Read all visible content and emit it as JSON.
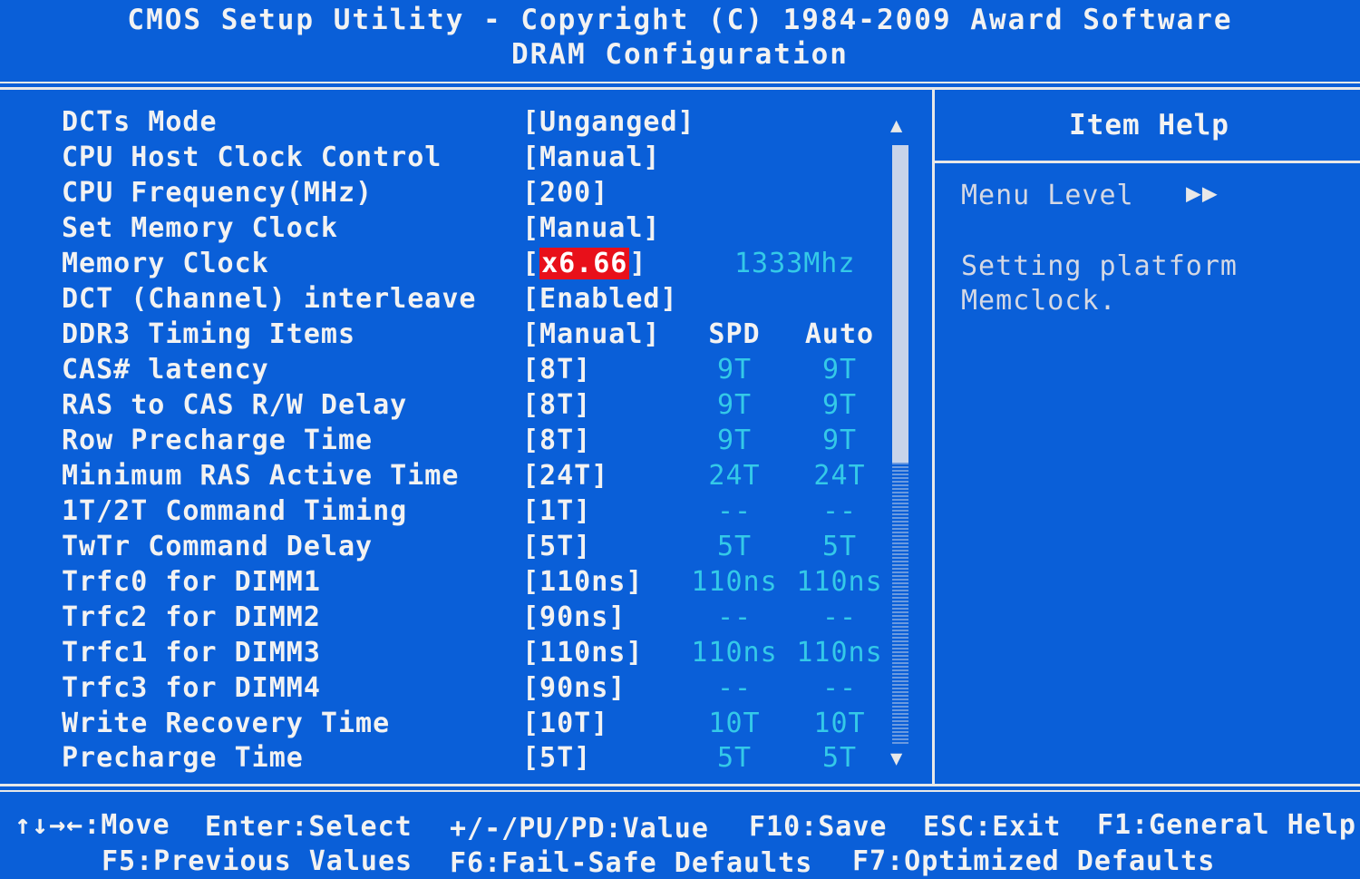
{
  "header": {
    "title": "CMOS Setup Utility - Copyright (C) 1984-2009 Award Software",
    "subtitle": "DRAM Configuration"
  },
  "settings": [
    {
      "label": "DCTs Mode",
      "value": "[Unganged]"
    },
    {
      "label": "CPU Host Clock Control",
      "value": "[Manual]"
    },
    {
      "label": "CPU Frequency(MHz)",
      "value": "[200]"
    },
    {
      "label": "Set Memory Clock",
      "value": "[Manual]"
    },
    {
      "label": "Memory Clock",
      "value_open": "[",
      "value_selected": "x6.66",
      "value_close": "]",
      "extra": "1333Mhz"
    },
    {
      "label": "DCT (Channel) interleave",
      "value": "[Enabled]"
    },
    {
      "label": "DDR3 Timing Items",
      "value": "[Manual]",
      "spd": "SPD",
      "auto": "Auto"
    },
    {
      "label": "CAS# latency",
      "value": "[8T]",
      "spd": "9T",
      "auto": "9T"
    },
    {
      "label": "RAS to CAS R/W Delay",
      "value": "[8T]",
      "spd": "9T",
      "auto": "9T"
    },
    {
      "label": "Row Precharge Time",
      "value": "[8T]",
      "spd": "9T",
      "auto": "9T"
    },
    {
      "label": "Minimum RAS Active Time",
      "value": "[24T]",
      "spd": "24T",
      "auto": "24T"
    },
    {
      "label": "1T/2T Command Timing",
      "value": "[1T]",
      "spd": "--",
      "auto": "--"
    },
    {
      "label": "TwTr Command Delay",
      "value": "[5T]",
      "spd": "5T",
      "auto": "5T"
    },
    {
      "label": "Trfc0 for DIMM1",
      "value": "[110ns]",
      "spd": "110ns",
      "auto": "110ns"
    },
    {
      "label": "Trfc2 for DIMM2",
      "value": "[90ns]",
      "spd": "--",
      "auto": "--"
    },
    {
      "label": "Trfc1 for DIMM3",
      "value": "[110ns]",
      "spd": "110ns",
      "auto": "110ns"
    },
    {
      "label": "Trfc3 for DIMM4",
      "value": "[90ns]",
      "spd": "--",
      "auto": "--"
    },
    {
      "label": "Write Recovery Time",
      "value": "[10T]",
      "spd": "10T",
      "auto": "10T"
    },
    {
      "label": "Precharge Time",
      "value": "[5T]",
      "spd": "5T",
      "auto": "5T"
    }
  ],
  "scrollbar": {
    "up_arrow": "▲",
    "down_arrow": "▼"
  },
  "help": {
    "title": "Item Help",
    "menu_level_label": "Menu Level",
    "menu_level_value": "▶▶",
    "text_line1": "Setting platform",
    "text_line2": "Memclock."
  },
  "footer": {
    "move": "↑↓→←:Move",
    "enter": "Enter:Select",
    "value": "+/-/PU/PD:Value",
    "save": "F10:Save",
    "exit": "ESC:Exit",
    "general_help": "F1:General Help",
    "previous": "F5:Previous Values",
    "failsafe": "F6:Fail-Safe Defaults",
    "optimized": "F7:Optimized Defaults"
  },
  "colors": {
    "background": "#0a5fd8",
    "highlight": "#e8101a",
    "secondary_text": "#34c9e8"
  }
}
